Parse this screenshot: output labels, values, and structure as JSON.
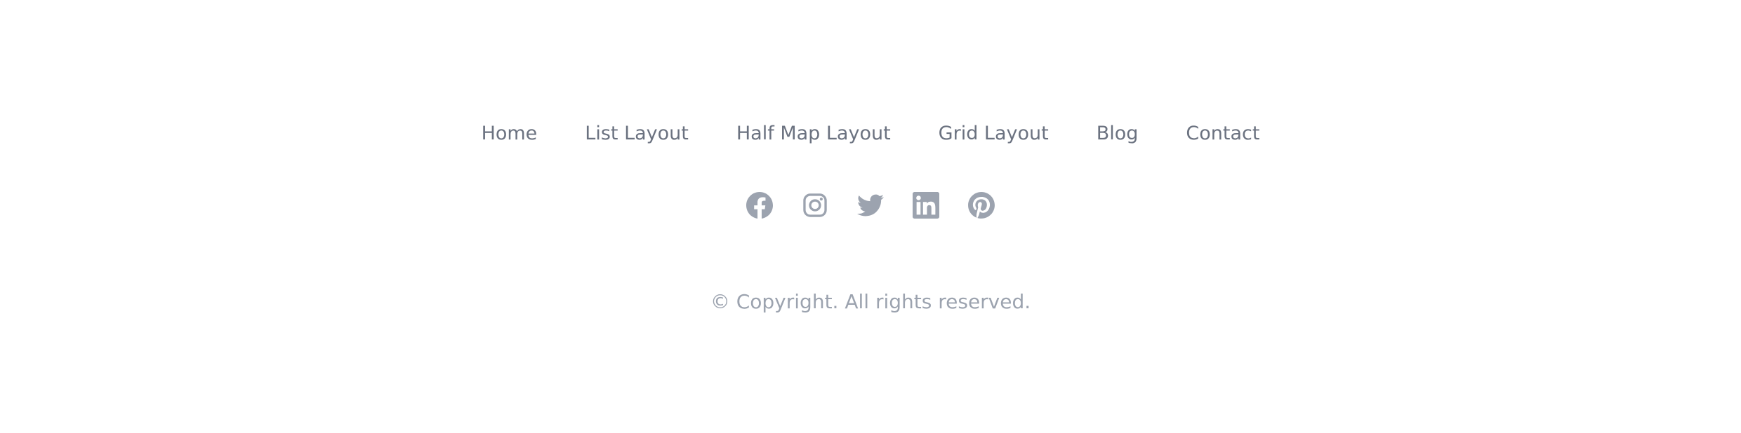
{
  "nav": {
    "items": [
      {
        "label": "Home"
      },
      {
        "label": "List Layout"
      },
      {
        "label": "Half Map Layout"
      },
      {
        "label": "Grid Layout"
      },
      {
        "label": "Blog"
      },
      {
        "label": "Contact"
      }
    ]
  },
  "social": {
    "icons": [
      "facebook-icon",
      "instagram-icon",
      "twitter-icon",
      "linkedin-icon",
      "pinterest-icon"
    ],
    "icon_color": "#9ca3af"
  },
  "colors": {
    "nav_text": "#6b7280",
    "copyright_text": "#9ca3af",
    "background": "#ffffff"
  },
  "copyright": {
    "text": "© Copyright. All rights reserved."
  }
}
